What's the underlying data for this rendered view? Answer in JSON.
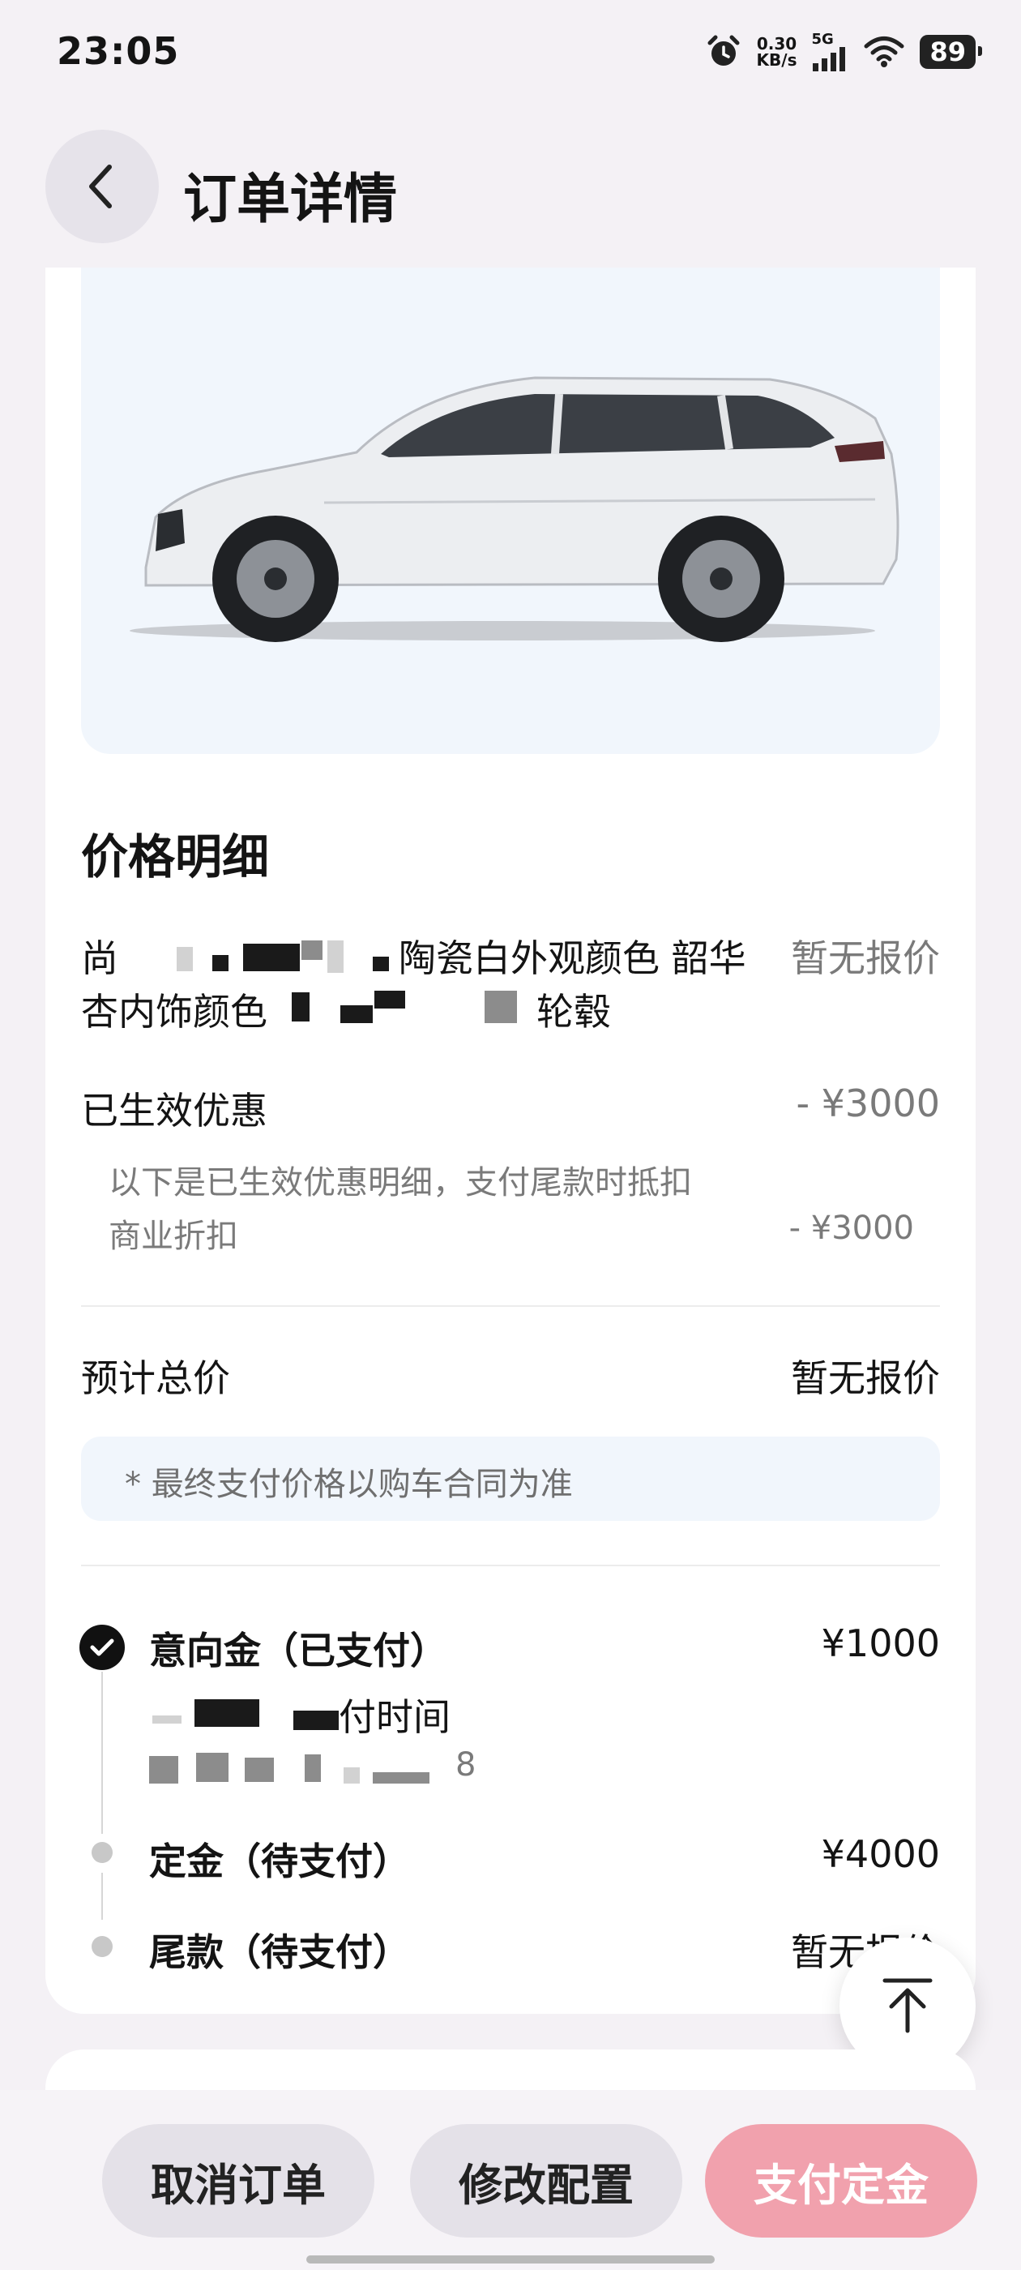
{
  "status_bar": {
    "time": "23:05",
    "net_speed_value": "0.30",
    "net_speed_unit": "KB/s",
    "network": "5G",
    "battery": "89"
  },
  "header": {
    "title": "订单详情"
  },
  "price_detail": {
    "title": "价格明细",
    "config_line1": "尚",
    "config_line1_tail": "陶瓷白外观颜色 韶华",
    "config_line2": "杏内饰颜色",
    "config_line2_tail": "轮毂",
    "config_price": "暂无报价",
    "discount_label": "已生效优惠",
    "discount_value": "- ¥3000",
    "discount_note": "以下是已生效优惠明细，支付尾款时抵扣",
    "discount_item_label": "商业折扣",
    "discount_item_value": "- ¥3000",
    "total_label": "预计总价",
    "total_value": "暂无报价",
    "final_note": "* 最终支付价格以购车合同为准"
  },
  "payments": [
    {
      "label": "意向金（已支付）",
      "amount": "¥1000",
      "status": "paid",
      "sub_label": "付时间",
      "sub_value_tail": "8"
    },
    {
      "label": "定金（待支付）",
      "amount": "¥4000",
      "status": "pending"
    },
    {
      "label": "尾款（待支付）",
      "amount": "暂无报价",
      "status": "pending"
    }
  ],
  "actions": {
    "cancel": "取消订单",
    "modify": "修改配置",
    "pay": "支付定金"
  },
  "colors": {
    "accent_pink": "#f1a1ad",
    "car_bg": "#f1f6fc"
  }
}
